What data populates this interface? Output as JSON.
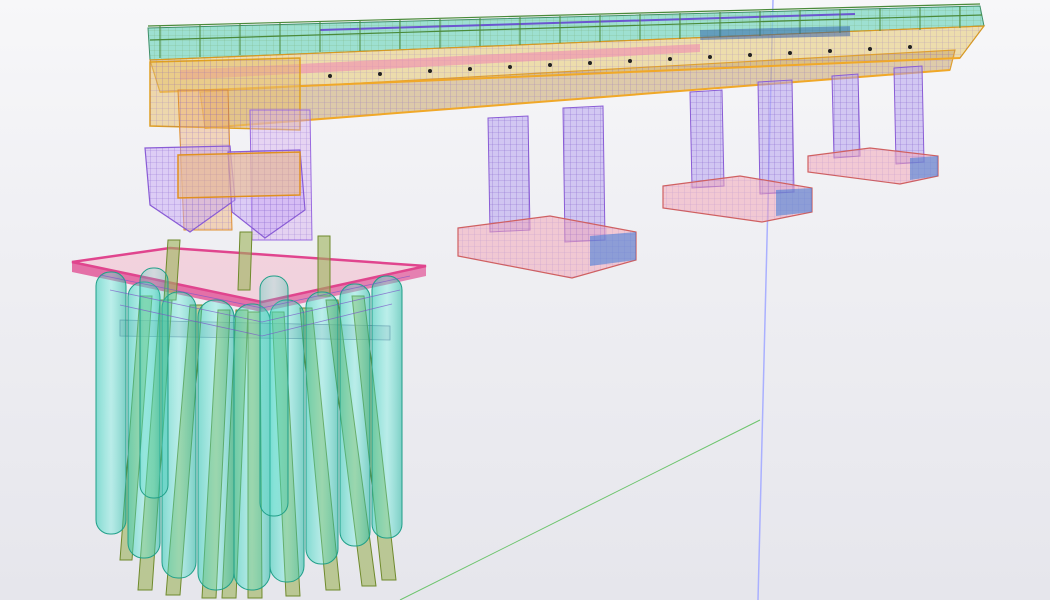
{
  "viewport": {
    "background_colors": [
      "#f7f7f9",
      "#e6e6ec"
    ],
    "colors": {
      "deck_top": "#7fd8c4",
      "deck_frame": "#f0b030",
      "rebar": "#8a5cd6",
      "pier_shaft": "#b6a3ef",
      "pile_cap": "#f3a8b8",
      "pile_cap_rim": "#e0458e",
      "casing_piles": "#3fd6c0",
      "raked_piles": "#9db35a",
      "grid_line_vertical": "#aab0ff",
      "grid_line_ground": "#6cc46c"
    },
    "components": [
      "deck",
      "railing",
      "abutment",
      "pier",
      "pile-cap",
      "casing-pile",
      "raked-pile",
      "grid-line"
    ]
  }
}
